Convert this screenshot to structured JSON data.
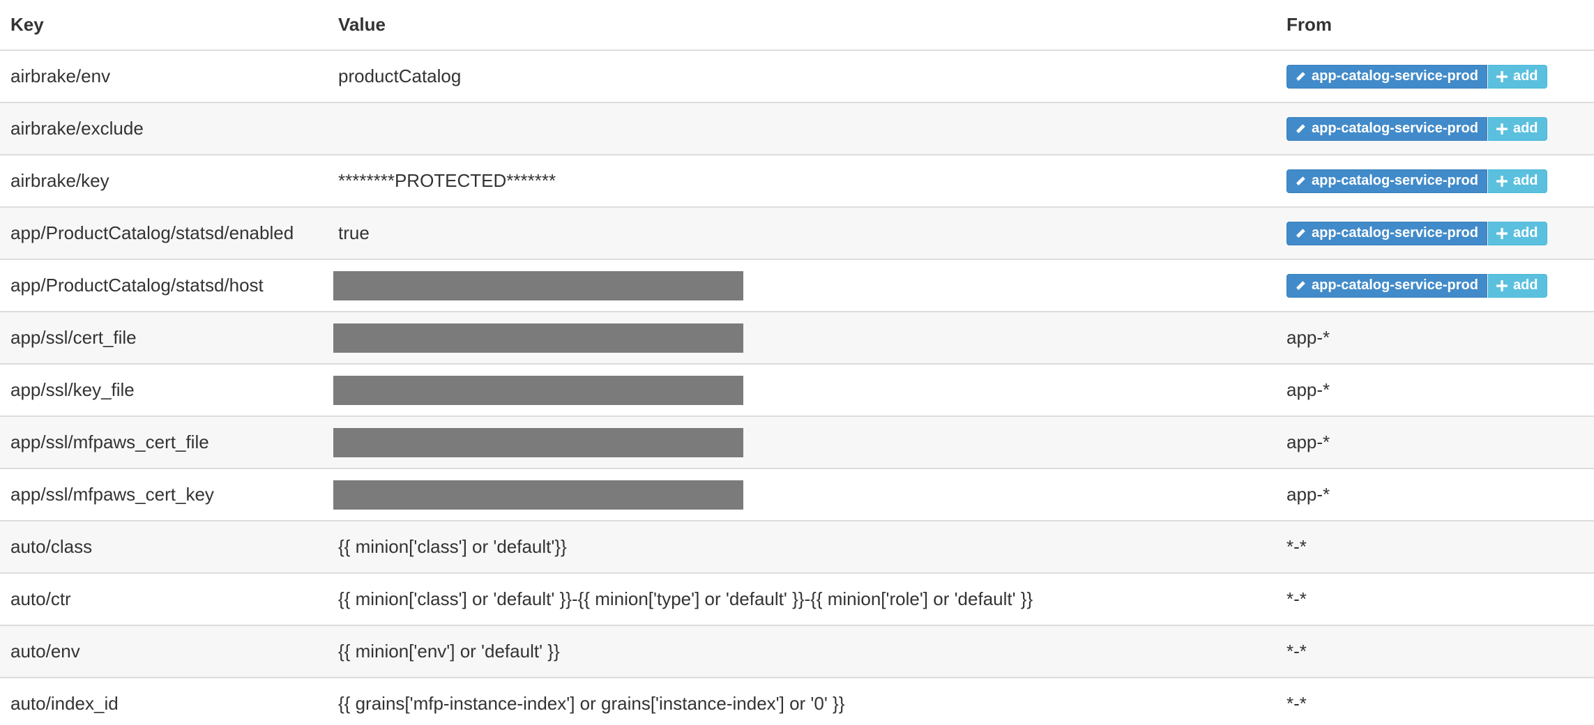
{
  "table": {
    "headers": {
      "key": "Key",
      "value": "Value",
      "from": "From"
    },
    "rows": [
      {
        "key": "airbrake/env",
        "value": "productCatalog",
        "from_button": "app-catalog-service-prod",
        "add_button": "add"
      },
      {
        "key": "airbrake/exclude",
        "value": "",
        "from_button": "app-catalog-service-prod",
        "add_button": "add"
      },
      {
        "key": "airbrake/key",
        "value": "********PROTECTED*******",
        "from_button": "app-catalog-service-prod",
        "add_button": "add"
      },
      {
        "key": "app/ProductCatalog/statsd/enabled",
        "value": "true",
        "from_button": "app-catalog-service-prod",
        "add_button": "add"
      },
      {
        "key": "app/ProductCatalog/statsd/host",
        "value_redacted": true,
        "from_button": "app-catalog-service-prod",
        "add_button": "add"
      },
      {
        "key": "app/ssl/cert_file",
        "value_redacted": true,
        "from": "app-*"
      },
      {
        "key": "app/ssl/key_file",
        "value_redacted": true,
        "from": "app-*"
      },
      {
        "key": "app/ssl/mfpaws_cert_file",
        "value_redacted": true,
        "from": "app-*"
      },
      {
        "key": "app/ssl/mfpaws_cert_key",
        "value_redacted": true,
        "from": "app-*"
      },
      {
        "key": "auto/class",
        "value": "{{ minion['class'] or 'default'}}",
        "from": "*-*"
      },
      {
        "key": "auto/ctr",
        "value": "{{ minion['class'] or 'default' }}-{{ minion['type'] or 'default' }}-{{ minion['role'] or 'default' }}",
        "from": "*-*"
      },
      {
        "key": "auto/env",
        "value": "{{ minion['env'] or 'default' }}",
        "from": "*-*"
      },
      {
        "key": "auto/index_id",
        "value": "{{ grains['mfp-instance-index'] or grains['instance-index'] or '0' }}",
        "from": "*-*"
      }
    ]
  },
  "icons": {
    "edit": "pencil-icon",
    "add": "plus-icon"
  },
  "colors": {
    "primary_button": "#428bca",
    "info_button": "#5bc0de",
    "redaction": "#7b7b7b",
    "striped_row": "#f7f7f7"
  }
}
